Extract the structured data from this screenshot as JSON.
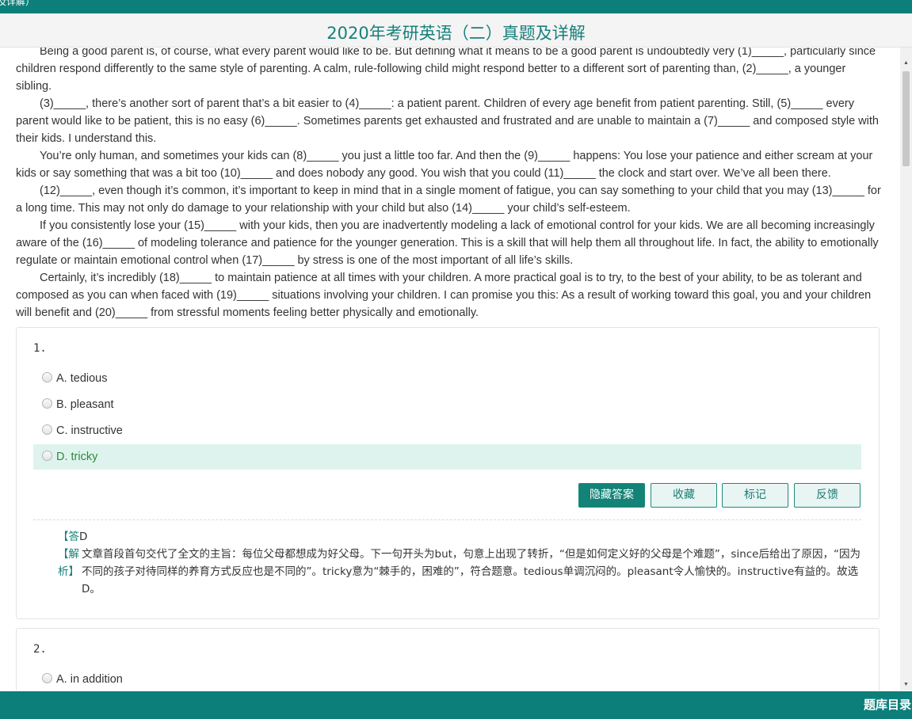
{
  "top_strip_text": "及详解）",
  "header": {
    "title": "2020年考研英语（二）真题及详解"
  },
  "passage": [
    "Being a good parent is, of course, what every parent would like to be. But defining what it means to be a good parent is undoubtedly very (1)_____, particularly since children respond differently to the same style of parenting. A calm, rule-following child might respond better to a different sort of parenting than, (2)_____, a younger sibling.",
    "(3)_____, there’s another sort of parent that’s a bit easier to (4)_____: a patient parent. Children of every age benefit from patient parenting. Still, (5)_____ every parent would like to be patient, this is no easy (6)_____. Sometimes parents get exhausted and frustrated and are unable to maintain a (7)_____ and composed style with their kids. I understand this.",
    "You’re only human, and sometimes your kids can (8)_____ you just a little too far. And then the (9)_____ happens: You lose your patience and either scream at your kids or say something that was a bit too (10)_____ and does nobody any good. You wish that you could (11)_____ the clock and start over. We’ve all been there.",
    "(12)_____, even though it’s common, it’s important to keep in mind that in a single moment of fatigue, you can say something to your child that you may (13)_____ for a long time. This may not only do damage to your relationship with your child but also (14)_____ your child’s self-esteem.",
    "If you consistently lose your (15)_____ with your kids, then you are inadvertently modeling a lack of emotional control for your kids. We are all becoming increasingly aware of the (16)_____ of modeling tolerance and patience for the younger generation. This is a skill that will help them all throughout life. In fact, the ability to emotionally regulate or maintain emotional control when (17)_____ by stress is one of the most important of all life’s skills.",
    "Certainly, it’s incredibly (18)_____ to maintain patience at all times with your children. A more practical goal is to try, to the best of your ability, to be as tolerant and composed as you can when faced with (19)_____ situations involving your children. I can promise you this: As a result of working toward this goal, you and your children will benefit and (20)_____ from stressful moments feeling better physically and emotionally."
  ],
  "questions": [
    {
      "number": "1.",
      "options": [
        "A. tedious",
        "B. pleasant",
        "C. instructive",
        "D. tricky"
      ],
      "correct_index": 3,
      "answer_label": "【答",
      "answer_value": "D",
      "explain_label": "【解析】",
      "explanation": "文章首段首句交代了全文的主旨：每位父母都想成为好父母。下一句开头为but，句意上出现了转折，“但是如何定义好的父母是个难题”，since后给出了原因，“因为不同的孩子对待同样的养育方式反应也是不同的”。tricky意为“棘手的，困难的”，符合题意。tedious单调沉闷的。pleasant令人愉快的。instructive有益的。故选D。"
    },
    {
      "number": "2.",
      "options": [
        "A. in addition"
      ]
    }
  ],
  "buttons": {
    "hide_answer": "隐藏答案",
    "favorite": "收藏",
    "mark": "标记",
    "feedback": "反馈"
  },
  "footer": {
    "catalog": "题库目录"
  },
  "colors": {
    "brand": "#0d7f7a",
    "correct_bg": "#dff3ee",
    "correct_text": "#2e8a3c"
  }
}
